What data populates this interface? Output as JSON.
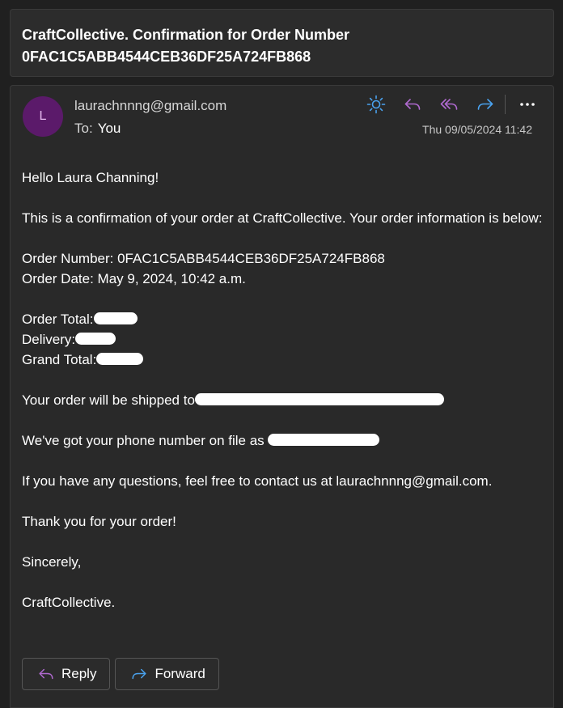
{
  "subject": "CraftCollective. Confirmation for Order Number\n0FAC1C5ABB4544CEB36DF25A724FB868",
  "header": {
    "avatar_initial": "L",
    "sender": "laurachnnng@gmail.com",
    "to_label": "To:",
    "to_value": "You",
    "timestamp": "Thu 09/05/2024 11:42"
  },
  "toolbar": {
    "icons": [
      "sun-icon",
      "reply-icon",
      "reply-all-icon",
      "forward-icon",
      "more-icon"
    ],
    "more_label": "···"
  },
  "body": {
    "greeting": "Hello Laura Channing!",
    "intro": "This is a confirmation of your order at CraftCollective. Your order information is below:",
    "order_number": "Order Number: 0FAC1C5ABB4544CEB36DF25A724FB868",
    "order_date": "Order Date: May 9, 2024, 10:42 a.m.",
    "order_total_label": "Order Total:",
    "delivery_label": "Delivery:",
    "grand_total_label": "Grand Total:",
    "shipping": "Your order will be shipped to",
    "phone": "We've got your phone number on file as",
    "questions": "If you have any questions, feel free to contact us at laurachnnng@gmail.com.",
    "thanks": "Thank you for your order!",
    "signoff": "Sincerely,",
    "signature": "CraftCollective."
  },
  "actions": {
    "reply_label": "Reply",
    "forward_label": "Forward"
  },
  "colors": {
    "background": "#202020",
    "card": "#292929",
    "accent_blue": "#4aa3f0",
    "accent_purple": "#b06ad0",
    "avatar_bg": "#5b1a6a"
  }
}
